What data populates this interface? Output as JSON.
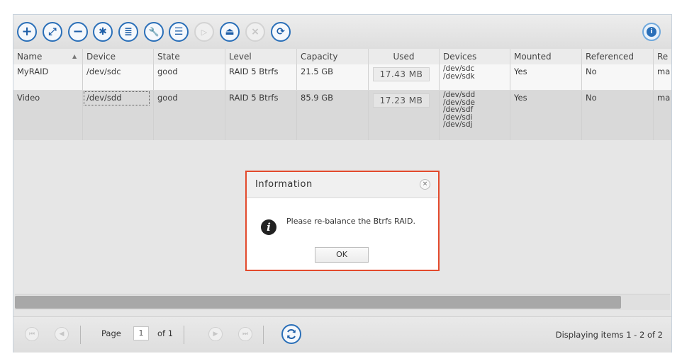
{
  "toolbar": {
    "buttons": [
      {
        "name": "add-icon",
        "glyph": "+"
      },
      {
        "name": "expand-icon",
        "glyph": "⤢"
      },
      {
        "name": "remove-icon",
        "glyph": "−"
      },
      {
        "name": "recover-icon",
        "glyph": "✱"
      },
      {
        "name": "storage-icon",
        "glyph": "≣"
      },
      {
        "name": "wrench-icon",
        "glyph": "🔧"
      },
      {
        "name": "details-icon",
        "glyph": "☰"
      },
      {
        "name": "play-icon",
        "glyph": "▷"
      },
      {
        "name": "eject-icon",
        "glyph": "⏏"
      },
      {
        "name": "close-icon",
        "glyph": "×"
      },
      {
        "name": "sync-icon",
        "glyph": "⟳"
      }
    ],
    "info_glyph": "i"
  },
  "grid": {
    "columns": [
      "Name",
      "Device",
      "State",
      "Level",
      "Capacity",
      "Used",
      "Devices",
      "Mounted",
      "Referenced",
      "Re"
    ],
    "rows": [
      {
        "name": "MyRAID",
        "device": "/dev/sdc",
        "state": "good",
        "level": "RAID 5 Btrfs",
        "capacity": "21.5 GB",
        "used": "17.43 MB",
        "devices": [
          "/dev/sdc",
          "/dev/sdk"
        ],
        "mounted": "Yes",
        "referenced": "No",
        "re": "ma"
      },
      {
        "name": "Video",
        "device": "/dev/sdd",
        "state": "good",
        "level": "RAID 5 Btrfs",
        "capacity": "85.9 GB",
        "used": "17.23 MB",
        "devices": [
          "/dev/sdd",
          "/dev/sde",
          "/dev/sdf",
          "/dev/sdi",
          "/dev/sdj"
        ],
        "mounted": "Yes",
        "referenced": "No",
        "re": "ma"
      }
    ]
  },
  "pager": {
    "page_label": "Page",
    "page_value": "1",
    "of_label": "of 1",
    "display_info": "Displaying items 1 - 2 of 2"
  },
  "dialog": {
    "title": "Information",
    "message": "Please re-balance the Btrfs RAID.",
    "ok_label": "OK",
    "close_glyph": "×",
    "icon_glyph": "i",
    "border_color": "#e34a2c"
  },
  "colors": {
    "accent": "#2a6fb8",
    "selected_row": "#d9d9d9"
  }
}
